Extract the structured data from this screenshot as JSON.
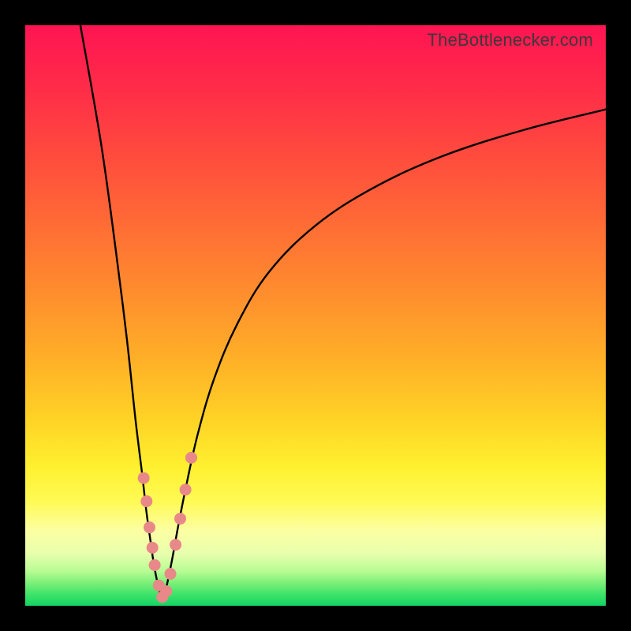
{
  "attribution": "TheBottlenecker.com",
  "colors": {
    "frame": "#000000",
    "gradient_top": "#ff1453",
    "gradient_bottom": "#13d464",
    "curve": "#000000",
    "marker": "#e98888"
  },
  "chart_data": {
    "type": "line",
    "title": "",
    "xlabel": "",
    "ylabel": "",
    "xlim": [
      0,
      100
    ],
    "ylim": [
      0,
      100
    ],
    "note": "No axes or tick labels are rendered in the source image; x/y values below are read off the plot area as percentages (0 = left/bottom, 100 = right/top).",
    "series": [
      {
        "name": "left-branch",
        "x": [
          9.5,
          13.0,
          15.5,
          17.5,
          19.0,
          20.1,
          20.9,
          21.6,
          22.1,
          22.6,
          23.0,
          23.3,
          23.6
        ],
        "y": [
          100.0,
          80.0,
          62.0,
          46.0,
          32.0,
          23.0,
          16.0,
          11.0,
          7.5,
          4.8,
          3.0,
          1.8,
          1.2
        ]
      },
      {
        "name": "right-branch",
        "x": [
          23.6,
          24.0,
          24.6,
          25.4,
          26.4,
          27.8,
          29.7,
          32.5,
          36.5,
          42.0,
          50.0,
          60.0,
          72.0,
          86.0,
          100.0
        ],
        "y": [
          1.2,
          2.0,
          4.5,
          8.5,
          14.0,
          21.0,
          29.5,
          39.0,
          48.5,
          57.5,
          65.5,
          72.0,
          77.5,
          82.0,
          85.5
        ]
      }
    ],
    "markers": {
      "name": "highlight-dots",
      "color": "#e98888",
      "points": [
        {
          "x": 20.4,
          "y": 22.0
        },
        {
          "x": 20.9,
          "y": 18.0
        },
        {
          "x": 21.4,
          "y": 13.5
        },
        {
          "x": 21.9,
          "y": 10.0
        },
        {
          "x": 22.3,
          "y": 7.0
        },
        {
          "x": 23.0,
          "y": 3.5
        },
        {
          "x": 23.6,
          "y": 1.5
        },
        {
          "x": 24.3,
          "y": 2.5
        },
        {
          "x": 25.0,
          "y": 5.5
        },
        {
          "x": 25.9,
          "y": 10.5
        },
        {
          "x": 26.7,
          "y": 15.0
        },
        {
          "x": 27.6,
          "y": 20.0
        },
        {
          "x": 28.6,
          "y": 25.5
        }
      ]
    }
  }
}
